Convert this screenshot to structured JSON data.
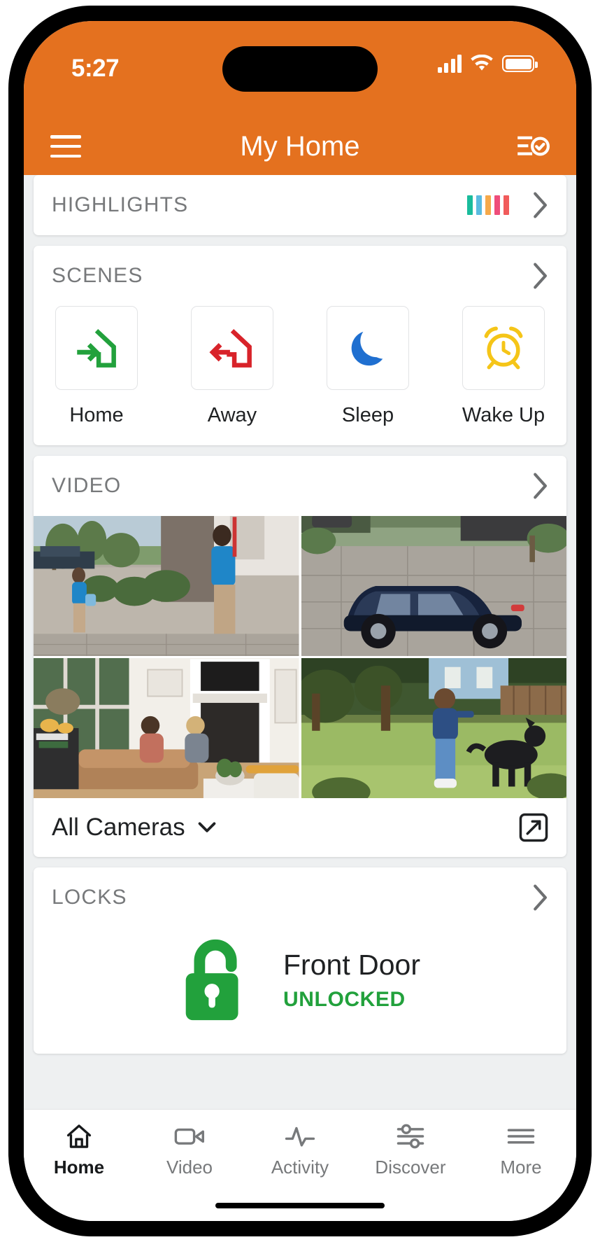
{
  "status_bar": {
    "time": "5:27",
    "signal_icon": "cellular-signal-icon",
    "wifi_icon": "wifi-icon",
    "battery_icon": "battery-full-icon"
  },
  "header": {
    "menu_icon": "hamburger-menu-icon",
    "title": "My Home",
    "action_icon": "list-check-icon"
  },
  "highlights": {
    "title": "HIGHLIGHTS",
    "chart_icon": "color-bars-icon",
    "bar_colors": [
      "#1abc9c",
      "#5bbbe0",
      "#f6a94a",
      "#ef4d7a",
      "#f15b5b"
    ],
    "chevron_icon": "chevron-right-icon"
  },
  "scenes": {
    "title": "SCENES",
    "chevron_icon": "chevron-right-icon",
    "items": [
      {
        "label": "Home",
        "icon": "home-arrow-in-icon",
        "color": "#22a13c"
      },
      {
        "label": "Away",
        "icon": "home-arrow-out-icon",
        "color": "#d8232a"
      },
      {
        "label": "Sleep",
        "icon": "crescent-moon-icon",
        "color": "#1f6fd0"
      },
      {
        "label": "Wake Up",
        "icon": "alarm-clock-icon",
        "color": "#f5c518"
      }
    ]
  },
  "video": {
    "title": "VIDEO",
    "chevron_icon": "chevron-right-icon",
    "cameras": [
      {
        "name": "front-door-camera",
        "scene": "woman-at-front-door-with-package"
      },
      {
        "name": "driveway-camera",
        "scene": "blue-suv-parked-in-driveway"
      },
      {
        "name": "living-room-camera",
        "scene": "family-seated-in-living-room"
      },
      {
        "name": "backyard-camera",
        "scene": "woman-with-dog-in-backyard"
      }
    ],
    "filter_label": "All Cameras",
    "filter_chevron_icon": "chevron-down-icon",
    "expand_icon": "expand-fullscreen-icon"
  },
  "locks": {
    "title": "LOCKS",
    "chevron_icon": "chevron-right-icon",
    "device_name": "Front Door",
    "status": "UNLOCKED",
    "status_color": "#22a13c",
    "lock_icon": "unlocked-padlock-icon"
  },
  "tab_bar": {
    "items": [
      {
        "label": "Home",
        "icon": "home-icon",
        "active": true
      },
      {
        "label": "Video",
        "icon": "video-camera-icon",
        "active": false
      },
      {
        "label": "Activity",
        "icon": "pulse-wave-icon",
        "active": false
      },
      {
        "label": "Discover",
        "icon": "discover-icon",
        "active": false
      },
      {
        "label": "More",
        "icon": "more-lines-icon",
        "active": false
      }
    ]
  },
  "theme": {
    "brand_orange": "#e4711f",
    "page_background": "#eef0f1",
    "card_background": "#ffffff",
    "label_gray": "#77797b"
  }
}
